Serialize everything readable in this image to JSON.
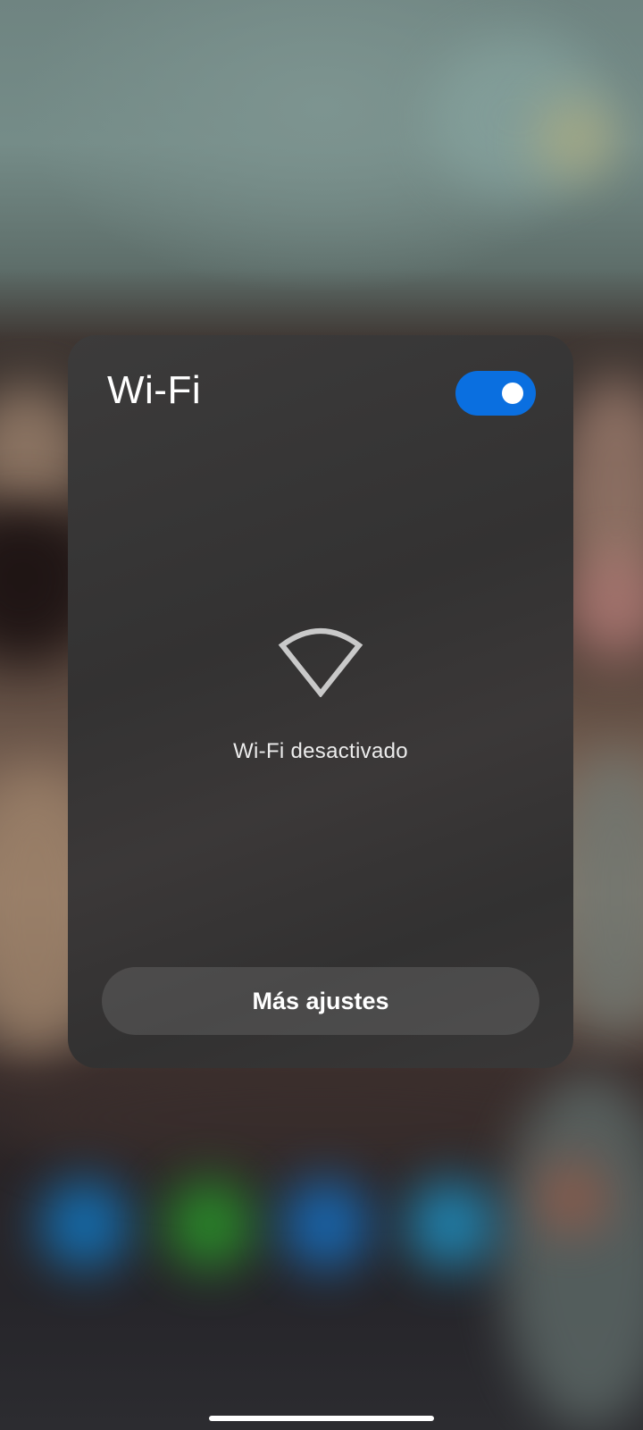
{
  "wifi_panel": {
    "title": "Wi-Fi",
    "toggle_on": true,
    "toggle_color": "#0a6fe0",
    "status_icon": "wifi-off-icon",
    "status_text": "Wi-Fi desactivado",
    "more_settings_label": "Más ajustes"
  },
  "background": {
    "dock_icon_colors": [
      "#0f7fd0",
      "#2aa02a",
      "#1477d0",
      "#1e9ad0"
    ]
  }
}
